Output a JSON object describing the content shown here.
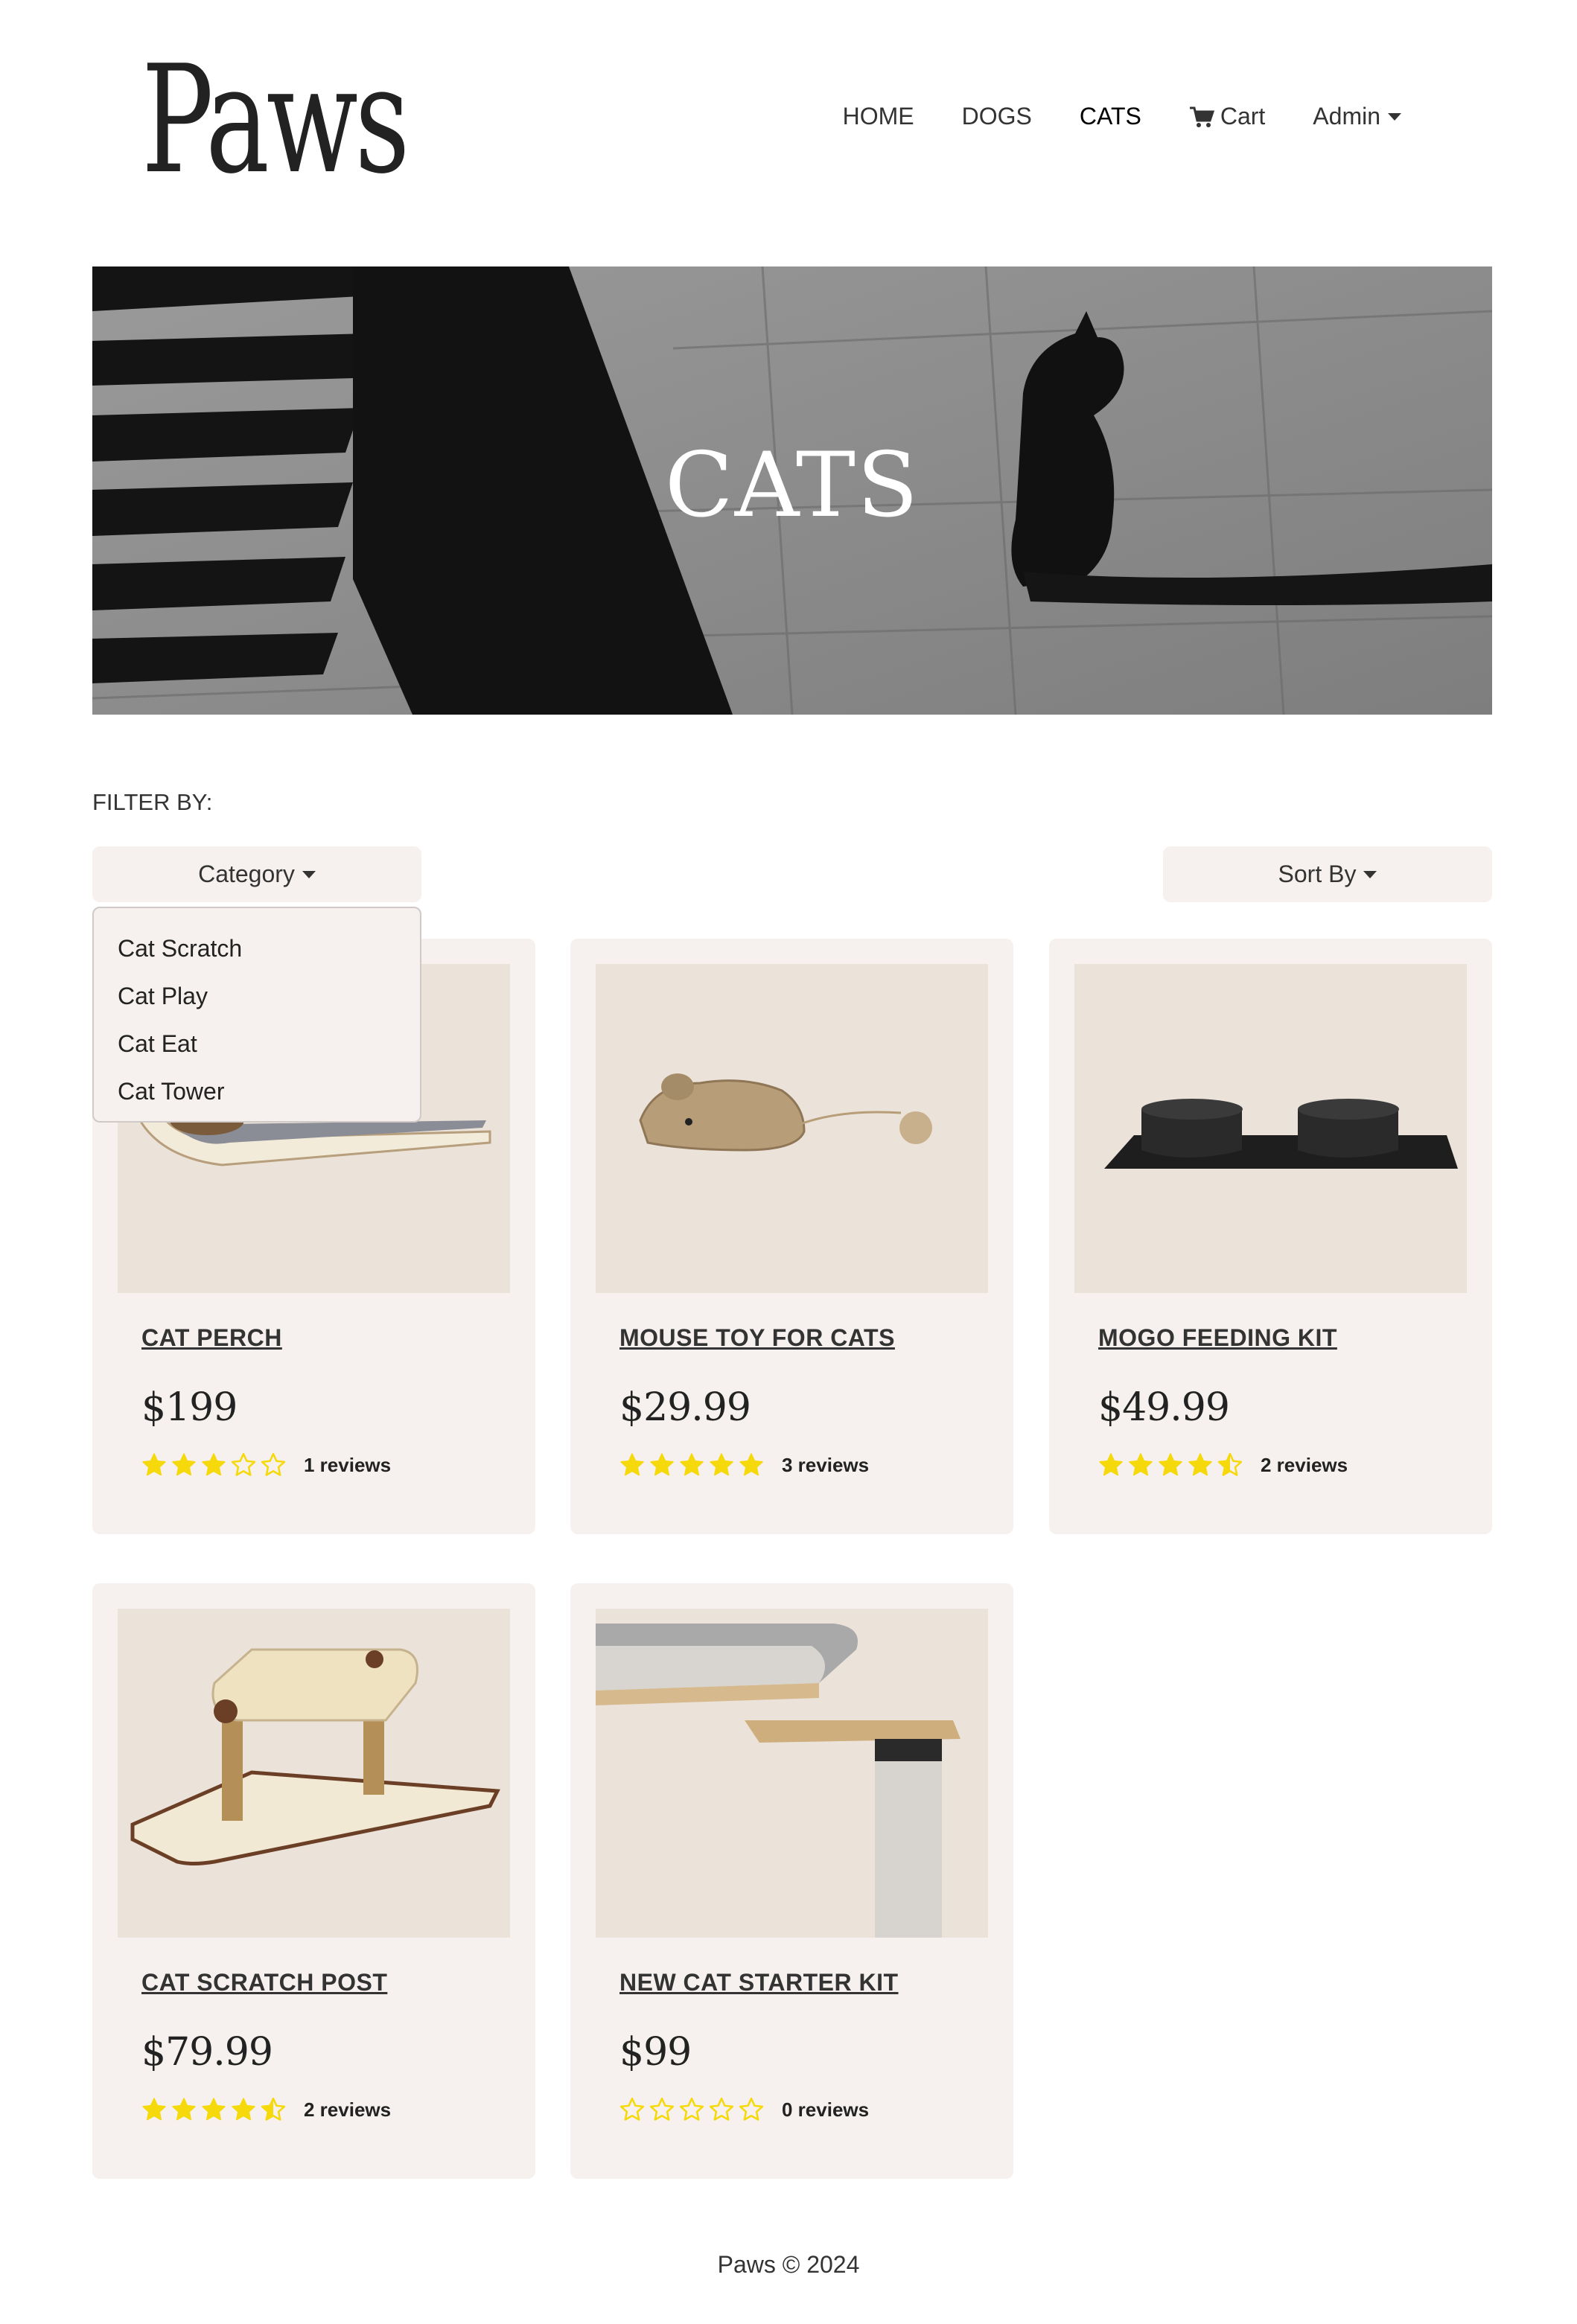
{
  "brand": {
    "logo_text": "Paws"
  },
  "nav": {
    "items": [
      {
        "label": "HOME"
      },
      {
        "label": "DOGS"
      },
      {
        "label": "CATS"
      }
    ],
    "cart_label": "Cart",
    "cart_icon": "cart-icon",
    "admin_label": "Admin",
    "active": "CATS"
  },
  "hero": {
    "title": "CATS"
  },
  "filter": {
    "label": "FILTER BY:",
    "category_label": "Category",
    "sort_label": "Sort By",
    "category_options": [
      "Cat Scratch",
      "Cat Play",
      "Cat Eat",
      "Cat Tower"
    ]
  },
  "products": [
    {
      "name": "CAT PERCH",
      "price": "$199",
      "rating": 3,
      "reviews": "1 reviews"
    },
    {
      "name": "MOUSE TOY FOR CATS",
      "price": "$29.99",
      "rating": 5,
      "reviews": "3 reviews"
    },
    {
      "name": "MOGO FEEDING KIT",
      "price": "$49.99",
      "rating": 4.5,
      "reviews": "2 reviews"
    },
    {
      "name": "CAT SCRATCH POST",
      "price": "$79.99",
      "rating": 4.5,
      "reviews": "2 reviews"
    },
    {
      "name": "NEW CAT STARTER KIT",
      "price": "$99",
      "rating": 0,
      "reviews": "0 reviews"
    }
  ],
  "colors": {
    "star": "#f5d90a",
    "card_bg": "#f6f1ee",
    "text": "#222222"
  },
  "footer": {
    "text": "Paws © 2024"
  }
}
